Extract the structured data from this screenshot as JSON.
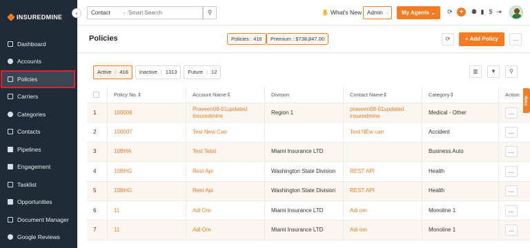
{
  "brand": {
    "logo_text": "INSUREDMINE",
    "accent": "#f37b21",
    "sidebar_bg": "#1f2b36"
  },
  "sidebar": {
    "items": [
      {
        "label": "Dashboard",
        "icon": "dashboard-icon"
      },
      {
        "label": "Accounts",
        "icon": "accounts-icon"
      },
      {
        "label": "Policies",
        "icon": "policies-icon",
        "active": true
      },
      {
        "label": "Carriers",
        "icon": "carriers-icon"
      },
      {
        "label": "Categories",
        "icon": "categories-icon"
      },
      {
        "label": "Contacts",
        "icon": "contacts-icon"
      },
      {
        "label": "Pipelines",
        "icon": "pipelines-icon"
      },
      {
        "label": "Engagement",
        "icon": "engagement-icon"
      },
      {
        "label": "Tasklist",
        "icon": "tasklist-icon"
      },
      {
        "label": "Opportunities",
        "icon": "opportunities-icon"
      },
      {
        "label": "Document Manager",
        "icon": "document-manager-icon"
      },
      {
        "label": "Google Reviews",
        "icon": "google-reviews-icon"
      }
    ]
  },
  "topbar": {
    "search_scope": "Contact",
    "search_placeholder": "Smart Search",
    "whats_new": "What's New",
    "role": "Admin",
    "my_agents": "My Agents"
  },
  "header": {
    "title": "Policies",
    "policies_badge": "Policies : 416",
    "premium_badge": "Premium : $738,847.00",
    "add_policy": "Add Policy"
  },
  "filters": [
    {
      "label": "Active",
      "count": "416",
      "active": true
    },
    {
      "label": "Inactive",
      "count": "1313"
    },
    {
      "label": "Future",
      "count": "12"
    }
  ],
  "table": {
    "headers": [
      "Policy No.",
      "Account Name",
      "Division",
      "Contact Name",
      "Category",
      "Action"
    ],
    "rows": [
      {
        "idx": "1",
        "policy": "100006",
        "account": "Praveen08-01updated Insuredmine",
        "division": "Region 1",
        "contact": "praveen08-01updated insuredmine",
        "category": "Medical - Other"
      },
      {
        "idx": "2",
        "policy": "100007",
        "account": "Test New Carr",
        "division": "",
        "contact": "Test NEw carr",
        "category": "Accident"
      },
      {
        "idx": "3",
        "policy": "10BHA",
        "account": "Test Tebd",
        "division": "Miami Insurance LTD",
        "contact": "",
        "category": "Business Auto"
      },
      {
        "idx": "4",
        "policy": "10BHG",
        "account": "Rest Api",
        "division": "Washington State Division",
        "contact": "REST API",
        "category": "Health"
      },
      {
        "idx": "5",
        "policy": "10BHG",
        "account": "Rest Api",
        "division": "Washington State Division",
        "contact": "REST API",
        "category": "Health"
      },
      {
        "idx": "6",
        "policy": "11",
        "account": "Adi Om",
        "division": "Miami Insurance LTD",
        "contact": "Adi om",
        "category": "Monoline 1"
      },
      {
        "idx": "7",
        "policy": "11",
        "account": "Adi Om",
        "division": "Miami Insurance LTD",
        "contact": "Adi om",
        "category": "Monoline 1"
      }
    ]
  },
  "help_tab": "Help"
}
